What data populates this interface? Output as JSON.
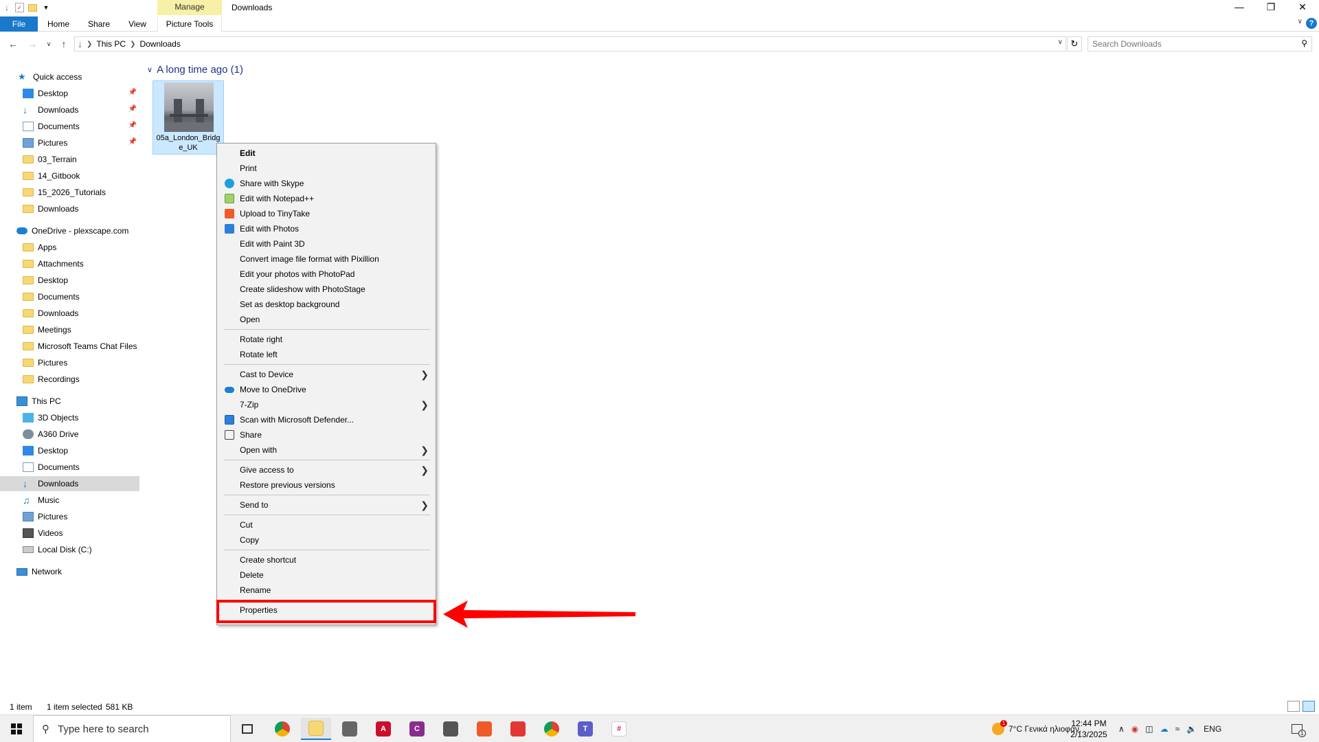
{
  "window": {
    "title": "Downloads",
    "manage_tab": "Manage",
    "minimize": "—",
    "restore": "❐",
    "close": "✕"
  },
  "ribbon": {
    "tabs": [
      "File",
      "Home",
      "Share",
      "View",
      "Picture Tools"
    ],
    "help": "?"
  },
  "address": {
    "segments": [
      "This PC",
      "Downloads"
    ],
    "search_placeholder": "Search Downloads"
  },
  "nav": {
    "quick_access": "Quick access",
    "quick_items": [
      "Desktop",
      "Downloads",
      "Documents",
      "Pictures",
      "03_Terrain",
      "14_Gitbook",
      "15_2026_Tutorials",
      "Downloads"
    ],
    "onedrive": "OneDrive - plexscape.com",
    "onedrive_items": [
      "Apps",
      "Attachments",
      "Desktop",
      "Documents",
      "Downloads",
      "Meetings",
      "Microsoft Teams Chat Files",
      "Pictures",
      "Recordings"
    ],
    "this_pc": "This PC",
    "pc_items": [
      "3D Objects",
      "A360 Drive",
      "Desktop",
      "Documents",
      "Downloads",
      "Music",
      "Pictures",
      "Videos",
      "Local Disk (C:)"
    ],
    "network": "Network"
  },
  "content": {
    "group_header": "A long time ago (1)",
    "file_name": "05a_London_Bridge_UK"
  },
  "context_menu": {
    "items": [
      "Edit",
      "Print",
      "Share with Skype",
      "Edit with Notepad++",
      "Upload to TinyTake",
      "Edit with Photos",
      "Edit with Paint 3D",
      "Convert image file format with Pixillion",
      "Edit your photos with PhotoPad",
      "Create slideshow with PhotoStage",
      "Set as desktop background",
      "Open",
      "Rotate right",
      "Rotate left",
      "Cast to Device",
      "Move to OneDrive",
      "7-Zip",
      "Scan with Microsoft Defender...",
      "Share",
      "Open with",
      "Give access to",
      "Restore previous versions",
      "Send to",
      "Cut",
      "Copy",
      "Create shortcut",
      "Delete",
      "Rename",
      "Properties"
    ],
    "highlight_color": "#ff0000"
  },
  "status": {
    "item_count": "1 item",
    "selection": "1 item selected",
    "size": "581 KB"
  },
  "taskbar": {
    "search_placeholder": "Type here to search",
    "weather": "7°C  Γενικά ηλιοφάν.",
    "language": "ENG",
    "time": "12:44 PM",
    "date": "2/13/2025",
    "notification_count": "1",
    "weather_badge": "1"
  },
  "colors": {
    "accent": "#1979ca",
    "selection": "#cce8ff",
    "manage_tab": "#f7f0a6"
  }
}
